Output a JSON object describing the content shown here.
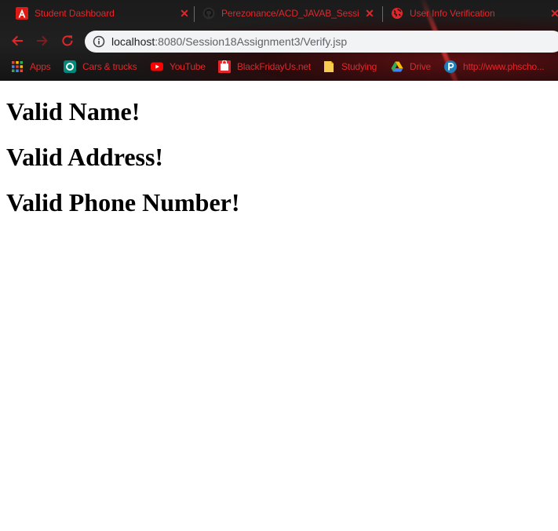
{
  "tabs": [
    {
      "title": "Student Dashboard",
      "favicon": "angular-icon"
    },
    {
      "title": "Perezonance/ACD_JAVAB_Session",
      "favicon": "github-icon"
    },
    {
      "title": "User Info Verification",
      "favicon": "globe-icon"
    }
  ],
  "toolbar": {
    "url_host": "localhost",
    "url_rest": ":8080/Session18Assignment3/Verify.jsp"
  },
  "bookmarks": [
    {
      "label": "Apps",
      "icon": "apps-grid-icon"
    },
    {
      "label": "Cars & trucks",
      "icon": "cars-icon"
    },
    {
      "label": "YouTube",
      "icon": "youtube-icon"
    },
    {
      "label": "BlackFridayUs.net",
      "icon": "blackfriday-icon"
    },
    {
      "label": "Studying",
      "icon": "folder-icon"
    },
    {
      "label": "Drive",
      "icon": "drive-icon"
    },
    {
      "label": "http://www.phscho...",
      "icon": "pearson-icon"
    }
  ],
  "page": {
    "messages": [
      "Valid Name!",
      "Valid Address!",
      "Valid Phone Number!"
    ]
  },
  "colors": {
    "theme_text": "#e3262a",
    "chrome_bg": "#1b1b1b"
  }
}
